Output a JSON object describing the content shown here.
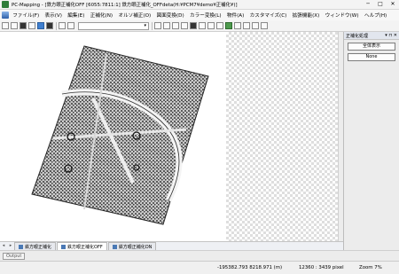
{
  "window": {
    "title": "PC-Mapping - [鉄方眼正補化OFF [6055:7811:1] 鉄方眼正補化_OFFdeta(H:¥PCM7¥demo¥正補化¥)]",
    "minimize": "─",
    "maximize": "□",
    "close": "✕"
  },
  "menu": [
    "ファイル(F)",
    "表示(V)",
    "編集(E)",
    "正補化(N)",
    "オルソ補正(O)",
    "図面変換(D)",
    "カラー変換(L)",
    "物件(A)",
    "カスタマイズ(C)",
    "拡張機能(X)",
    "ウィンドウ(W)",
    "ヘルプ(H)"
  ],
  "toolbar": {
    "select_value": "▾"
  },
  "panel": {
    "title": "正補化処理",
    "pin": "▾ ⊓ ✕",
    "buttons": [
      "全体表示",
      "None"
    ]
  },
  "tabs": {
    "left_arrow": "◂",
    "right_arrow": "▸",
    "items": [
      {
        "label": "鉄方眼正補化",
        "active": false
      },
      {
        "label": "鉄方眼正補化OFF",
        "active": true
      },
      {
        "label": "鉄方眼正補化ON",
        "active": false
      }
    ]
  },
  "output": {
    "label": "Output"
  },
  "status": {
    "coords": "-195382.793   8218.971 (m)",
    "pixel": "12360 :  3439 pixel",
    "zoom": "Zoom    7%"
  }
}
